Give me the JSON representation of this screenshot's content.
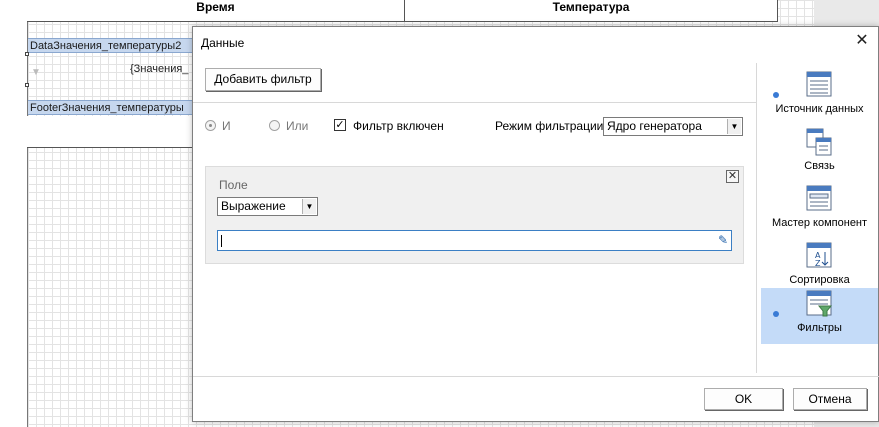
{
  "designer": {
    "header_time": "Время",
    "header_temp": "Температура",
    "data_band": "DataЗначения_температуры2",
    "data_text": "{Значения_",
    "footer_band": "FooterЗначения_температуры"
  },
  "dialog": {
    "title": "Данные",
    "add_filter": "Добавить фильтр",
    "opt_and": "И",
    "opt_or": "Или",
    "filter_enabled": "Фильтр включен",
    "filter_mode_label": "Режим фильтрации",
    "filter_mode_value": "Ядро генератора",
    "field_label": "Поле",
    "field_type_value": "Выражение",
    "expression_value": "",
    "ok": "OK",
    "cancel": "Отмена"
  },
  "nav": [
    {
      "label": "Источник данных",
      "icon": "data-source-icon",
      "dot": true,
      "active": false
    },
    {
      "label": "Связь",
      "icon": "relation-icon",
      "dot": false,
      "active": false
    },
    {
      "label": "Мастер компонент",
      "icon": "master-component-icon",
      "dot": false,
      "active": false
    },
    {
      "label": "Сортировка",
      "icon": "sort-icon",
      "dot": false,
      "active": false
    },
    {
      "label": "Фильтры",
      "icon": "filter-icon",
      "dot": true,
      "active": true
    }
  ],
  "colors": {
    "accent": "#3a7bd5",
    "active_nav": "#c4dbf8",
    "band": "#c6d7ee"
  }
}
